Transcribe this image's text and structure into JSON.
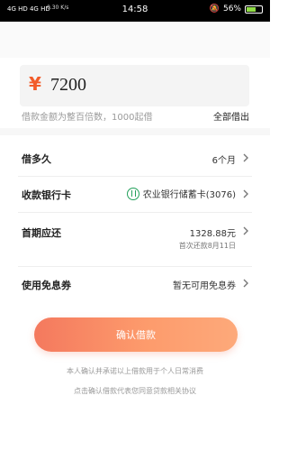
{
  "status_bar": {
    "signal": "4G HD 4G HD",
    "net_speed": "0.30 K/s",
    "time": "14:58",
    "battery_percent": "56%",
    "battery_level": 0.56
  },
  "amount": {
    "currency": "¥",
    "value": "7200",
    "hint": "借款金额为整百倍数，1000起借",
    "borrow_all_label": "全部借出"
  },
  "rows": {
    "term": {
      "label": "借多久",
      "value": "6个月"
    },
    "bank": {
      "label": "收款银行卡",
      "value": "农业银行储蓄卡(3076)"
    },
    "first_payment": {
      "label": "首期应还",
      "value": "1328.88元",
      "sub": "首次还款8月11日"
    },
    "coupon": {
      "label": "使用免息券",
      "value": "暂无可用免息券"
    }
  },
  "confirm_label": "确认借款",
  "notes": {
    "line1": "本人确认并承诺以上借款用于个人日常消费",
    "line2": "点击确认借款代表您同意贷款相关协议"
  },
  "colors": {
    "accent": "#f25c2a",
    "button_start": "#f4795e",
    "button_end": "#fda97a",
    "bank_green": "#22a05a"
  }
}
